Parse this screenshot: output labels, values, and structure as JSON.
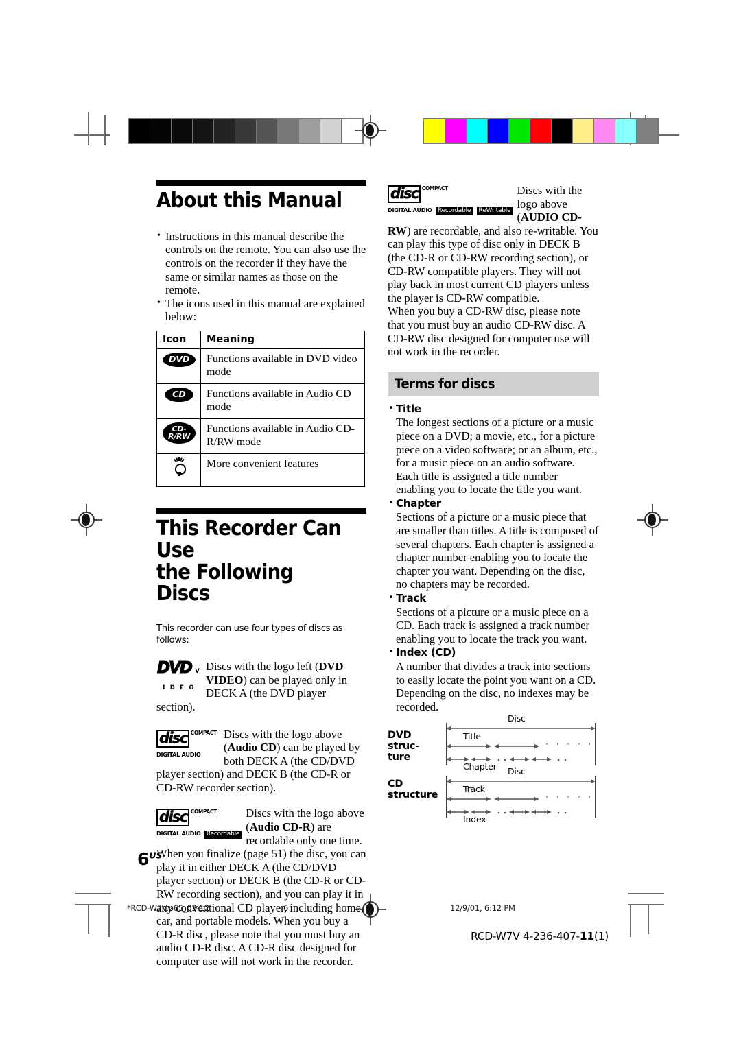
{
  "page": {
    "number_label": "6",
    "number_suffix": "US"
  },
  "calibration": {
    "gray_bar_colors": [
      "#000000",
      "#040404",
      "#0a0a0a",
      "#141414",
      "#232323",
      "#383838",
      "#555555",
      "#787878",
      "#9e9e9e",
      "#d2d2d2",
      "#ffffff"
    ],
    "color_bar_colors": [
      "#ffff00",
      "#ff00ff",
      "#00ffff",
      "#0000ff",
      "#00e800",
      "#ff0000",
      "#000000",
      "#ffee88",
      "#ff88ee",
      "#88ffff",
      "#808080"
    ]
  },
  "left_column": {
    "heading": "About this Manual",
    "intro_bullets": [
      "Instructions in this manual describe the controls on the remote. You can also use the controls on the recorder if they have the same or similar names as those on the remote.",
      "The icons used in this manual are explained below:"
    ],
    "icon_table": {
      "headers": [
        "Icon",
        "Meaning"
      ],
      "rows": [
        {
          "icon": "dvd-pill-icon",
          "icon_label": "DVD",
          "meaning": "Functions available in DVD video mode"
        },
        {
          "icon": "cd-pill-icon",
          "icon_label": "CD",
          "meaning": "Functions available in Audio CD mode"
        },
        {
          "icon": "cd-r-rw-pill-icon",
          "icon_label": "CD-R/RW",
          "meaning": "Functions available in Audio CD-R/RW mode"
        },
        {
          "icon": "lightbulb-icon",
          "icon_label": "",
          "meaning": "More convenient features"
        }
      ]
    },
    "heading2_line1": "This Recorder Can Use",
    "heading2_line2": "the Following Discs",
    "discs_intro": "This recorder can use four types of discs as follows:",
    "disc_dvd": {
      "logo_top": "DVD",
      "logo_bottom": "V I D E O",
      "text_a": "Discs with the logo left (",
      "bold_a": "DVD",
      "bold_b": "VIDEO",
      "text_b": ") can be played only in DECK A (the DVD player section)."
    },
    "disc_cd": {
      "logo_compact": "COMPACT",
      "logo_disc": "disc",
      "logo_digital": "DIGITAL AUDIO",
      "text_a": "Discs with the logo above (",
      "bold_a": "Audio",
      "bold_b": "CD",
      "text_b": ") can be played by both DECK A (the CD/DVD player section) and DECK B (the CD-R or CD-RW recorder section)."
    },
    "disc_cdr": {
      "logo_compact": "COMPACT",
      "logo_disc": "disc",
      "logo_digital": "DIGITAL AUDIO",
      "logo_tag1": "Recordable",
      "text_a": "Discs with the logo above (",
      "bold_a": "Audio",
      "bold_b": "CD-R",
      "text_b": ") are recordable only one time. When you finalize (page 51) the disc, you can play it in either DECK A (the CD/DVD player section) or DECK B (the CD-R or CD-RW recording section), and you can play it in any conventional CD player, including home, car, and portable models. When you buy a CD-R disc, please note that you must buy an audio CD-R disc. A CD-R disc designed for computer use will not work in the recorder."
    }
  },
  "right_column": {
    "disc_cdrw": {
      "logo_compact": "COMPACT",
      "logo_disc": "disc",
      "logo_digital": "DIGITAL AUDIO",
      "logo_tag1": "Recordable",
      "logo_tag2": "ReWritable",
      "text_a": "Discs with the logo above (",
      "bold_a": "AUDIO",
      "bold_b": "CD-RW",
      "text_b": ") are recordable, and also re-writable. You can play this type of disc only in DECK B (the CD-R or CD-RW recording section), or CD-RW compatible players. They will not play back in most current CD players unless the player is CD-RW compatible."
    },
    "cdrw_note": "When you buy a CD-RW disc, please note that you must buy an audio CD-RW disc. A CD-RW disc designed for computer use will not work in the recorder.",
    "terms_heading": "Terms for discs",
    "terms": [
      {
        "name": "Title",
        "body": "The longest sections of a picture or a music piece on a DVD; a movie, etc., for a picture piece on a video software; or an album, etc., for a music piece on an audio software. Each title is assigned a title number enabling you to locate the title you want."
      },
      {
        "name": "Chapter",
        "body": "Sections of a picture or a music piece that are smaller than titles. A title is composed of several chapters. Each chapter is assigned a chapter number enabling you to locate the chapter you want. Depending on the disc, no chapters may be recorded."
      },
      {
        "name": "Track",
        "body": "Sections of a picture or a music piece on a CD. Each track is assigned a track number enabling you to locate the track you want."
      },
      {
        "name": "Index (CD)",
        "body": "A number that divides a track into sections to easily locate the point you want on a CD. Depending on the disc, no indexes may be recorded."
      }
    ],
    "structure_diagram": {
      "dvd_label_line1": "DVD",
      "dvd_label_line2": "struc-",
      "dvd_label_line3": "ture",
      "cd_label_line1": "CD",
      "cd_label_line2": "structure",
      "dvd_disc_label": "Disc",
      "dvd_title_label": "Title",
      "dvd_chapter_label": "Chapter",
      "cd_disc_label": "Disc",
      "cd_track_label": "Track",
      "cd_index_label": "Index",
      "dots": "·  ·  ·  ·  ·"
    }
  },
  "footer": {
    "filename": "*RCD-W7V.p65_02-12",
    "page_number": "6",
    "timestamp": "12/9/01, 6:12 PM",
    "code_prefix": "RCD-W7V 4-236-407-",
    "code_bold": "11",
    "code_suffix": "(1)"
  }
}
